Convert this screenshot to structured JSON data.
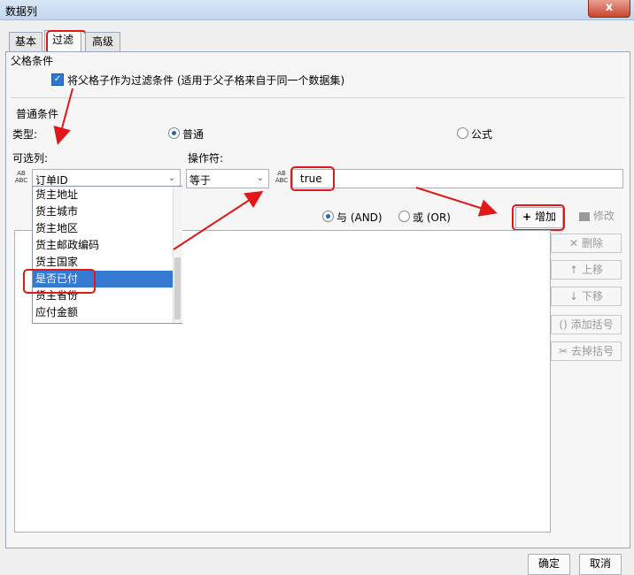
{
  "window": {
    "title": "数据列",
    "close_glyph": "x"
  },
  "tabs": [
    {
      "label": "基本"
    },
    {
      "label": "过滤"
    },
    {
      "label": "高级"
    }
  ],
  "parent_condition": {
    "section_title": "父格条件",
    "checkbox_label": "将父格子作为过滤条件 (适用于父子格来自于同一个数据集)",
    "checked": true
  },
  "normal_condition": {
    "section_title": "普通条件",
    "type_label": "类型:",
    "type_options": [
      {
        "label": "普通",
        "selected": true
      },
      {
        "label": "公式",
        "selected": false
      }
    ],
    "column_label": "可选列:",
    "operator_label": "操作符:",
    "column_value": "订单ID",
    "operator_value": "等于",
    "value_input": "true",
    "value_icon": "abc-field-icon"
  },
  "column_dropdown": {
    "items": [
      "货主地址",
      "货主城市",
      "货主地区",
      "货主邮政编码",
      "货主国家",
      "是否已付",
      "货主省份",
      "应付金额"
    ],
    "selected_index": 5
  },
  "logic": {
    "and_label": "与 (AND)",
    "or_label": "或 (OR)",
    "and_selected": true
  },
  "buttons": {
    "add": "增加",
    "edit": "修改",
    "delete": "删除",
    "move_up": "上移",
    "move_down": "下移",
    "add_bracket": "添加括号",
    "remove_bracket": "去掉括号",
    "ok": "确定",
    "cancel": "取消"
  },
  "icons": {
    "add": "+",
    "delete": "✕",
    "up": "↑",
    "down": "↓",
    "add_bracket": "()",
    "remove_bracket": "✂"
  },
  "colors": {
    "annotation_red": "#e01818",
    "selection_blue": "#3679d3"
  }
}
